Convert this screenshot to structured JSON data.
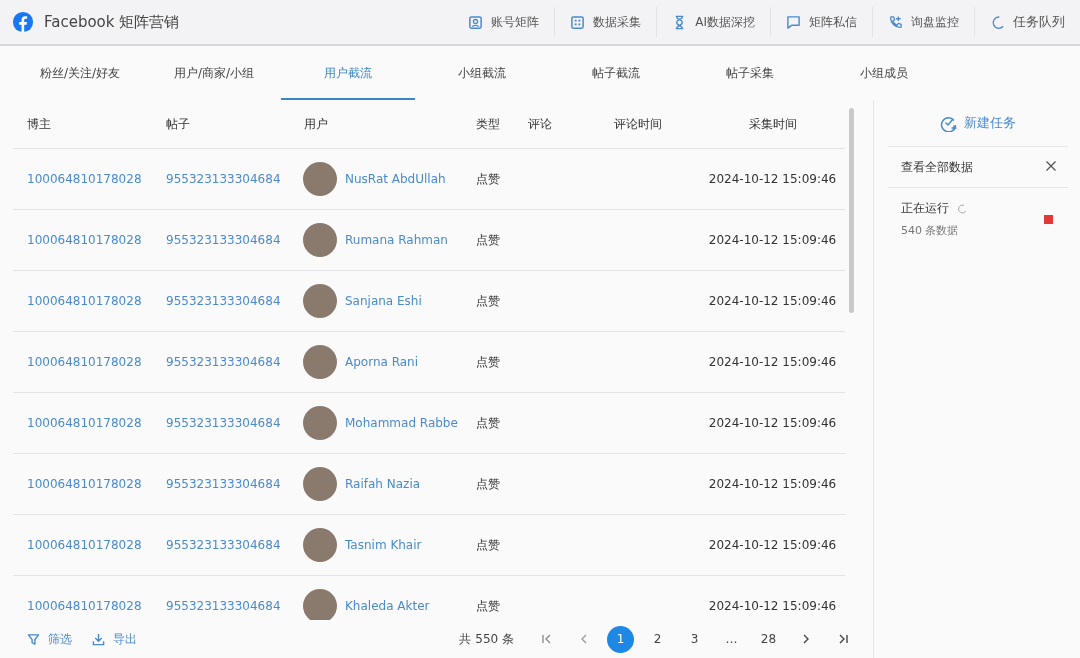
{
  "app": {
    "title": "Facebook 矩阵营销"
  },
  "nav": [
    {
      "kind": "account",
      "label": "账号矩阵"
    },
    {
      "kind": "grid",
      "label": "数据采集"
    },
    {
      "kind": "hourglass",
      "label": "AI数据深挖"
    },
    {
      "kind": "chat",
      "label": "矩阵私信"
    },
    {
      "kind": "phone",
      "label": "询盘监控"
    },
    {
      "kind": "spinner",
      "label": "任务队列"
    }
  ],
  "tabs": [
    {
      "label": "粉丝/关注/好友",
      "selected": false
    },
    {
      "label": "用户/商家/小组",
      "selected": false
    },
    {
      "label": "用户截流",
      "selected": true
    },
    {
      "label": "小组截流",
      "selected": false
    },
    {
      "label": "帖子截流",
      "selected": false
    },
    {
      "label": "帖子采集",
      "selected": false
    },
    {
      "label": "小组成员",
      "selected": false
    }
  ],
  "table": {
    "columns": [
      "博主",
      "帖子",
      "用户",
      "类型",
      "评论",
      "评论时间",
      "采集时间"
    ],
    "rows": [
      {
        "blogger": "100064810178028",
        "post": "955323133304684",
        "user": "NusRat AbdUllah",
        "type": "点赞",
        "collected": "2024-10-12 15:09:46"
      },
      {
        "blogger": "100064810178028",
        "post": "955323133304684",
        "user": "Rumana Rahman",
        "type": "点赞",
        "collected": "2024-10-12 15:09:46"
      },
      {
        "blogger": "100064810178028",
        "post": "955323133304684",
        "user": "Sanjana Eshi",
        "type": "点赞",
        "collected": "2024-10-12 15:09:46"
      },
      {
        "blogger": "100064810178028",
        "post": "955323133304684",
        "user": "Aporna Rani",
        "type": "点赞",
        "collected": "2024-10-12 15:09:46"
      },
      {
        "blogger": "100064810178028",
        "post": "955323133304684",
        "user": "Mohammad Rabbe",
        "type": "点赞",
        "collected": "2024-10-12 15:09:46"
      },
      {
        "blogger": "100064810178028",
        "post": "955323133304684",
        "user": "Raifah Nazia",
        "type": "点赞",
        "collected": "2024-10-12 15:09:46"
      },
      {
        "blogger": "100064810178028",
        "post": "955323133304684",
        "user": "Tasnim Khair",
        "type": "点赞",
        "collected": "2024-10-12 15:09:46"
      },
      {
        "blogger": "100064810178028",
        "post": "955323133304684",
        "user": "Khaleda Akter",
        "type": "点赞",
        "collected": "2024-10-12 15:09:46"
      }
    ]
  },
  "footer": {
    "filter": "筛选",
    "export": "导出",
    "total": "共 550 条",
    "pages": [
      {
        "label": "1",
        "selected": true
      },
      {
        "label": "2",
        "selected": false
      },
      {
        "label": "3",
        "selected": false
      },
      {
        "label": "…",
        "selected": false
      },
      {
        "label": "28",
        "selected": false
      }
    ]
  },
  "panel": {
    "new_task": "新建任务",
    "view_all": "查看全部数据",
    "tasks": [
      {
        "status": "正在运行",
        "count": "540 条数据",
        "running": true
      }
    ]
  }
}
